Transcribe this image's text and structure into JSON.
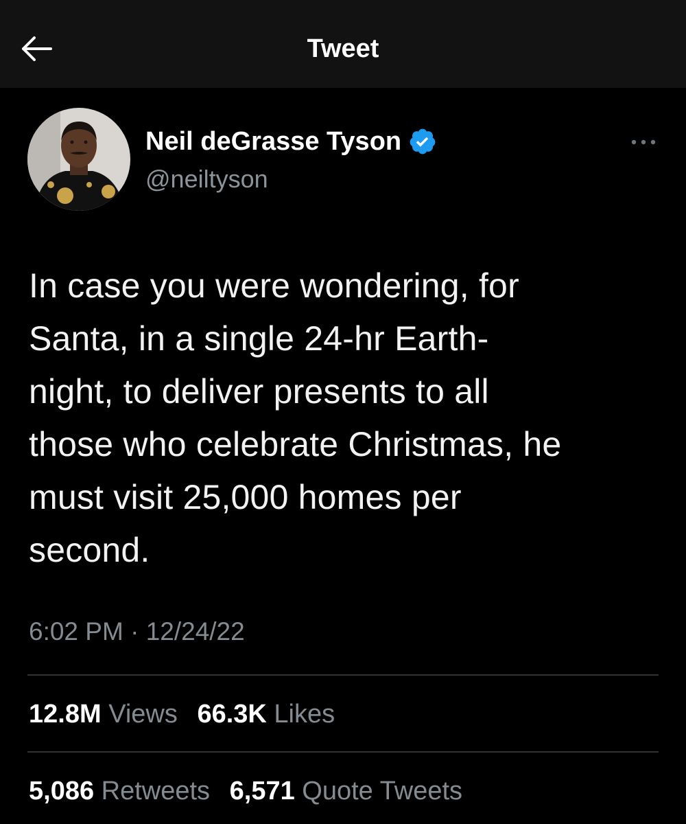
{
  "header": {
    "title": "Tweet",
    "back_icon": "back-arrow-icon"
  },
  "author": {
    "display_name": "Neil deGrasse Tyson",
    "handle": "@neiltyson",
    "verified": true,
    "verified_color": "#1d9bf0"
  },
  "tweet": {
    "text": "In case you were wondering, for\nSanta, in a single 24-hr Earth-\nnight, to deliver presents to all\nthose who celebrate Christmas, he\nmust visit 25,000 homes per\nsecond.",
    "time": "6:02 PM",
    "separator": "·",
    "date": "12/24/22"
  },
  "stats": {
    "views_count": "12.8M",
    "views_label": "Views",
    "likes_count": "66.3K",
    "likes_label": "Likes",
    "retweets_count": "5,086",
    "retweets_label": "Retweets",
    "quotes_count": "6,571",
    "quotes_label": "Quote Tweets"
  },
  "colors": {
    "background": "#000000",
    "header_background": "#121212",
    "text_primary": "#ffffff",
    "text_secondary": "#848b91",
    "accent": "#1d9bf0"
  }
}
